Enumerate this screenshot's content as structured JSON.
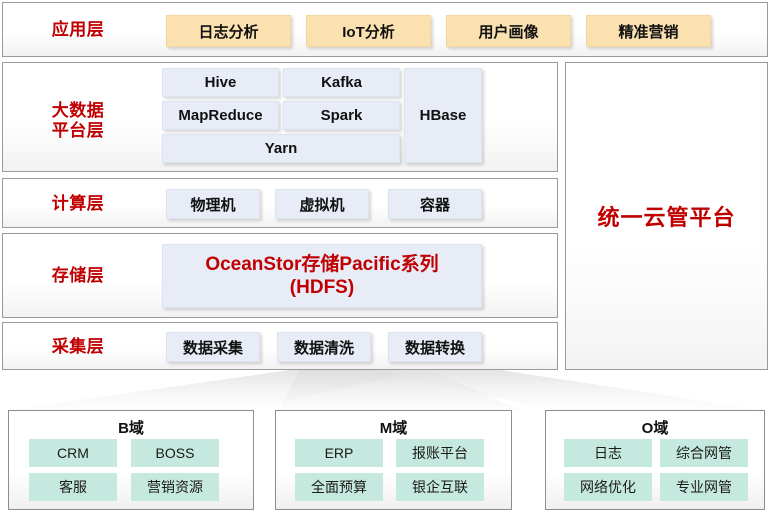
{
  "palette": {
    "app_tile": "#FBE0B0",
    "platform_tile": "#E7ECF7",
    "domain_tile": "#C5E8DF",
    "accent_red": "#C00000",
    "row_border": "#9A9A9A",
    "page_background": "#FFFFFF"
  },
  "layers": [
    {
      "label": "应用层",
      "tiles": [
        "日志分析",
        "IoT分析",
        "用户画像",
        "精准营销"
      ]
    },
    {
      "label": "大数据\n平台层",
      "tiles": [
        "Hive",
        "Kafka",
        "MapReduce",
        "Spark",
        "Yarn",
        "HBase"
      ]
    },
    {
      "label": "计算层",
      "tiles": [
        "物理机",
        "虚拟机",
        "容器"
      ]
    },
    {
      "label": "存储层",
      "tiles": [
        "OceanStor存储Pacific系列\n(HDFS)"
      ]
    },
    {
      "label": "采集层",
      "tiles": [
        "数据采集",
        "数据清洗",
        "数据转换"
      ]
    }
  ],
  "cloud_column": {
    "title": "统一云管平台"
  },
  "domains": [
    {
      "title": "B域",
      "tiles": [
        "CRM",
        "BOSS",
        "客服",
        "营销资源"
      ]
    },
    {
      "title": "M域",
      "tiles": [
        "ERP",
        "报账平台",
        "全面预算",
        "银企互联"
      ]
    },
    {
      "title": "O域",
      "tiles": [
        "日志",
        "综合网管",
        "网络优化",
        "专业网管"
      ]
    }
  ]
}
